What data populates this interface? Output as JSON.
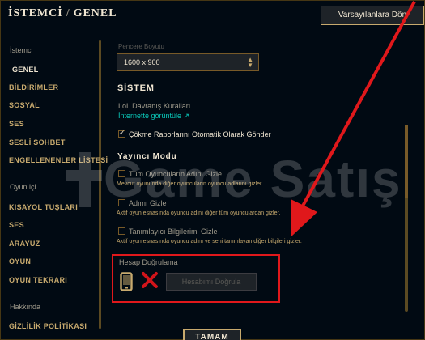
{
  "header": {
    "title_left": "İSTEMCİ",
    "title_sep": "/",
    "title_right": "GENEL",
    "reset_button": "Varsayılanlara Dön"
  },
  "sidebar": {
    "group_client": "İstemci",
    "items_client": [
      "GENEL",
      "BİLDİRİMLER",
      "SOSYAL",
      "SES",
      "SESLİ SOHBET",
      "ENGELLENENLER LİSTESİ"
    ],
    "group_ingame": "Oyun içi",
    "items_ingame": [
      "KISAYOL TUŞLARI",
      "SES",
      "ARAYÜZ",
      "OYUN",
      "OYUN TEKRARI"
    ],
    "group_about": "Hakkında",
    "items_about": [
      "GİZLİLİK POLİTİKASI"
    ]
  },
  "main": {
    "window_size_label": "Pencere Boyutu",
    "window_size_value": "1600 x 900",
    "system_title": "SİSTEM",
    "lol_rules": "LoL Davranış Kuralları",
    "view_online": "İnternette görüntüle ↗",
    "crash_reports": "Çökme Raporlarını Otomatik Olarak Gönder",
    "crash_reports_checked": true,
    "streamer_title": "Yayıncı Modu",
    "hide_all_names": "Tüm Oyuncuların Adını Gizle",
    "hide_all_names_desc": "Mevcut oyununda diğer oyuncuların oyuncu adlarını gizler.",
    "hide_name": "Adımı Gizle",
    "hide_name_desc": "Aktif oyun esnasında oyuncu adını diğer tüm oyunculardan gizler.",
    "hide_ids": "Tanımlayıcı Bilgilerimi Gizle",
    "hide_ids_desc": "Aktif oyun esnasında oyuncu adını ve seni tanımlayan diğer bilgileri gizler.",
    "verify_title": "Hesap Doğrulama",
    "verify_button": "Hesabımı Doğrula"
  },
  "footer": {
    "ok_button": "TAMAM"
  },
  "watermark": {
    "text": "Game Satış"
  },
  "icons": [
    "phone-icon",
    "x-icon",
    "chevron-up-down-icon",
    "external-link-icon",
    "red-arrow"
  ],
  "colors": {
    "gold": "#c8aa6e",
    "teal": "#0ac8b9",
    "background": "#010a13",
    "highlight": "#e0181b"
  }
}
